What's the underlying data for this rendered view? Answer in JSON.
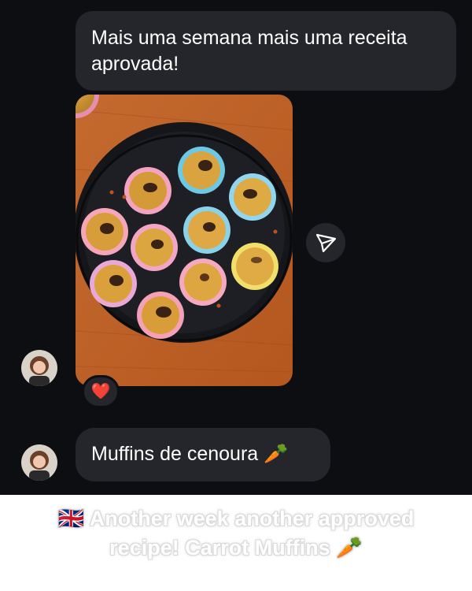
{
  "messages": [
    {
      "text": "Mais uma semana mais uma receita aprovada!"
    },
    {
      "text": "Muffins de cenoura 🥕"
    }
  ],
  "photo": {
    "icon": "muffin-tray-photo"
  },
  "reaction": {
    "emoji": "❤️"
  },
  "share": {
    "icon": "send-icon"
  },
  "caption": {
    "text": "🇬🇧 Another week another approved recipe! Carrot Muffins 🥕"
  },
  "colors": {
    "background": "#0d0e12",
    "bubble": "#25262b",
    "text": "#ffffff"
  }
}
